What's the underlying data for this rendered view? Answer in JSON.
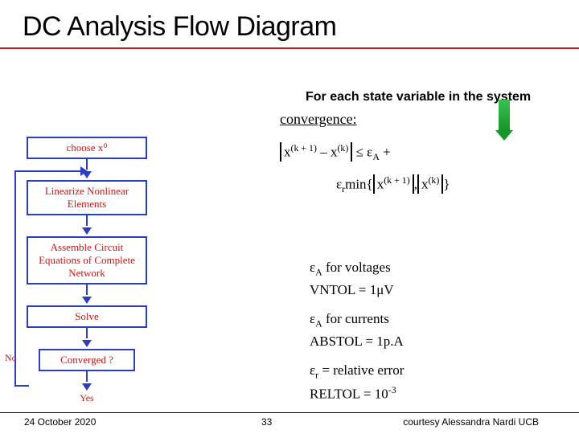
{
  "title": "DC Analysis Flow Diagram",
  "subtitle": "For each state variable in the system",
  "flow": {
    "choose": "choose x⁰",
    "linearize": "Linearize Nonlinear Elements",
    "assemble": "Assemble Circuit Equations of Complete Network",
    "solve": "Solve",
    "converged": "Converged ?",
    "no": "No",
    "yes": "Yes"
  },
  "convergence": {
    "heading": "convergence:",
    "line1_pre": "x",
    "line1_exp1": "(k + 1)",
    "line1_mid": " – x",
    "line1_exp2": "(k)",
    "line1_post": " ≤ ε",
    "line1_sub": "A",
    "line1_tail": "   +",
    "line2_pre": "ε",
    "line2_sub": "r",
    "line2_mid": "min{",
    "line2_x1": "x",
    "line2_e1": "(k + 1)",
    "line2_comma": ",",
    "line2_x2": "x",
    "line2_e2": "(k)",
    "line2_end": "}"
  },
  "tolerances": {
    "l1a": "ε",
    "l1b": "A",
    "l1c": " for voltages",
    "l2": "VNTOL = 1μV",
    "l3a": "ε",
    "l3b": "A",
    "l3c": " for currents",
    "l4": "ABSTOL = 1p.A",
    "l5a": "ε",
    "l5b": "r",
    "l5c": " = relative error",
    "l6a": "RELTOL = 10",
    "l6b": "-3"
  },
  "footer": {
    "date": "24 October 2020",
    "page": "33",
    "credit": "courtesy Alessandra Nardi UCB"
  }
}
